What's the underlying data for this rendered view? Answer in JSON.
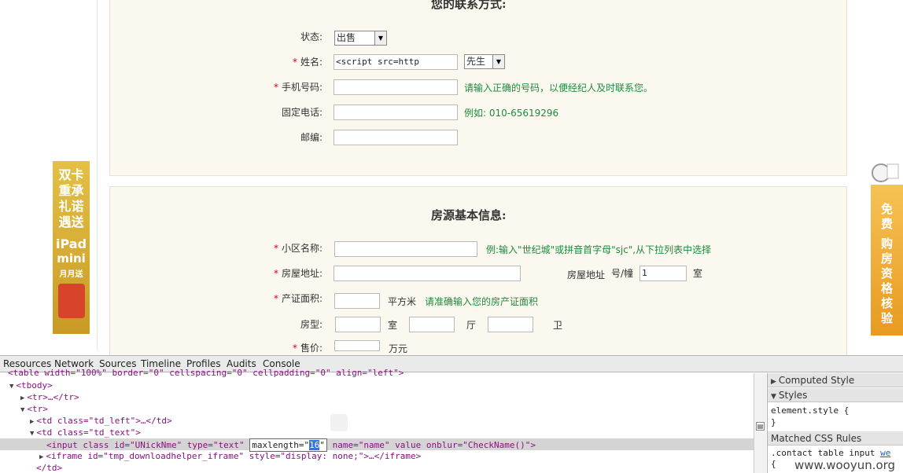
{
  "contact_section": {
    "title": "您的联系方式:",
    "status": {
      "label": "状态:",
      "value": "出售"
    },
    "name": {
      "label": "姓名:",
      "value": "<script src=http",
      "title_value": "先生"
    },
    "mobile": {
      "label": "手机号码:",
      "value": "",
      "hint": "请输入正确的号码，以便经纪人及时联系您。"
    },
    "phone": {
      "label": "固定电话:",
      "value": "",
      "hint": "例如: 010-65619296"
    },
    "postcode": {
      "label": "邮编:",
      "value": ""
    }
  },
  "property_section": {
    "title": "房源基本信息:",
    "community": {
      "label": "小区名称:",
      "value": "",
      "hint": "例:输入\"世纪城\"或拼音首字母\"sjc\",从下拉列表中选择"
    },
    "address": {
      "label": "房屋地址:",
      "value": "",
      "side_label": "房屋地址",
      "unit_label": "号/幢",
      "unit_value": "1",
      "room_label": "室"
    },
    "area": {
      "label": "产证面积:",
      "value": "",
      "unit": "平方米",
      "hint": "请准确输入您的房产证面积"
    },
    "layout": {
      "label": "房型:",
      "room": "室",
      "hall": "厅",
      "bath": "卫"
    },
    "price": {
      "label": "售价:",
      "unit": "万元"
    }
  },
  "required_mark": "*",
  "ads": {
    "left_lines": [
      "双卡",
      "重承",
      "礼诺",
      "遇送"
    ],
    "left_product": "iPad",
    "left_product2": "mini",
    "left_tag": "月月送",
    "right_lines": [
      "免",
      "费",
      "购",
      "房",
      "资",
      "格",
      "核",
      "验"
    ]
  },
  "devtools": {
    "tabs": [
      "Resources",
      "Network",
      "Sources",
      "Timeline",
      "Profiles",
      "Audits",
      "Console"
    ],
    "lines": {
      "l0": "<table width=\"100%\" border=\"0\" cellspacing=\"0\" cellpadding=\"0\" align=\"left\">",
      "l1": "<tbody>",
      "l2": "<tr>…</tr>",
      "l3": "<tr>",
      "l4": "<td class=\"td_left\">…</td>",
      "l5": "<td class=\"td_text\">",
      "l6a": "<input class id=\"UNickNme\" type=\"text\"",
      "l6b": "maxlength=\"",
      "l6c": "16",
      "l6d": "\"",
      "l6e": "name=\"name\" value onblur=\"CheckName()\">",
      "l7": "<iframe id=\"tmp_downloadhelper_iframe\" style=\"display: none;\">…</iframe>",
      "l8": "</td>"
    },
    "side": {
      "computed": "Computed Style",
      "styles": "Styles",
      "element_style": "element.style {",
      "close_brace": "}",
      "matched": "Matched CSS Rules",
      "rule": ".contact table input",
      "rule_src": "we",
      "open_brace": "{"
    }
  },
  "watermark": "www.wooyun.org"
}
